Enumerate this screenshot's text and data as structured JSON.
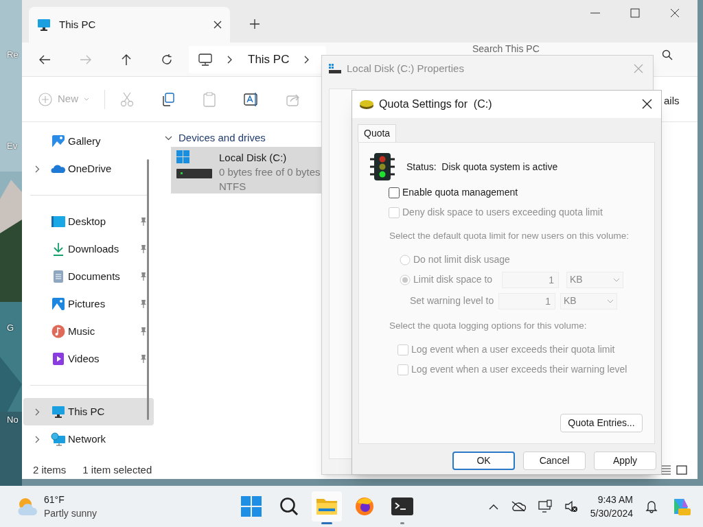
{
  "desktop": {
    "icon_labels": [
      "Re",
      "Ev",
      "G",
      "No"
    ]
  },
  "explorer": {
    "tab": {
      "title": "This PC"
    },
    "address": {
      "segments": [
        "This PC"
      ]
    },
    "search": {
      "placeholder": "Search This PC"
    },
    "toolbar": {
      "new_label": "New",
      "details_label": "ails"
    },
    "sidebar": {
      "groups": [
        [
          {
            "label": "Gallery",
            "expandable": false,
            "pinned": false,
            "selected": false
          },
          {
            "label": "OneDrive",
            "expandable": true,
            "pinned": false,
            "selected": false
          }
        ],
        [
          {
            "label": "Desktop",
            "expandable": false,
            "pinned": true,
            "selected": false
          },
          {
            "label": "Downloads",
            "expandable": false,
            "pinned": true,
            "selected": false
          },
          {
            "label": "Documents",
            "expandable": false,
            "pinned": true,
            "selected": false
          },
          {
            "label": "Pictures",
            "expandable": false,
            "pinned": true,
            "selected": false
          },
          {
            "label": "Music",
            "expandable": false,
            "pinned": true,
            "selected": false
          },
          {
            "label": "Videos",
            "expandable": false,
            "pinned": true,
            "selected": false
          }
        ],
        [
          {
            "label": "This PC",
            "expandable": true,
            "pinned": false,
            "selected": true
          },
          {
            "label": "Network",
            "expandable": true,
            "pinned": false,
            "selected": false
          }
        ]
      ]
    },
    "section": {
      "title": "Devices and drives",
      "expanded": true
    },
    "drives": [
      {
        "name": "Local Disk (C:)",
        "detail": "0 bytes free of 0 bytes",
        "filesystem": "NTFS",
        "selected": true
      }
    ],
    "status_bar": {
      "count": "2 items",
      "selection": "1 item selected"
    }
  },
  "properties_dialog": {
    "title": "Local Disk (C:) Properties"
  },
  "quota_dialog": {
    "title": "Quota Settings for  (C:)",
    "tabs": [
      {
        "label": "Quota",
        "selected": true
      }
    ],
    "status": "Status:  Disk quota system is active",
    "controls": [
      {
        "kind": "checkbox",
        "label": "Enable quota management",
        "checked": false,
        "disabled": false
      },
      {
        "kind": "checkbox",
        "label": "Deny disk space to users exceeding quota limit",
        "checked": false,
        "disabled": true
      },
      {
        "kind": "heading",
        "label": "Select the default quota limit for new users on this volume:"
      },
      {
        "kind": "radio",
        "label": "Do not limit disk usage",
        "selected": false,
        "disabled": true
      },
      {
        "kind": "radio",
        "label": "Limit disk space to",
        "selected": true,
        "disabled": true,
        "value": "1",
        "unit": "KB"
      },
      {
        "kind": "amount",
        "label": "Set warning level to",
        "disabled": true,
        "value": "1",
        "unit": "KB"
      },
      {
        "kind": "heading",
        "label": "Select the quota logging options for this volume:"
      },
      {
        "kind": "subcheckbox",
        "label": "Log event when a user exceeds their quota limit",
        "checked": false,
        "disabled": true
      },
      {
        "kind": "subcheckbox",
        "label": "Log event when a user exceeds their warning level",
        "checked": false,
        "disabled": true
      }
    ],
    "entries_button": "Quota Entries...",
    "buttons": [
      {
        "label": "OK",
        "default": true
      },
      {
        "label": "Cancel",
        "default": false
      },
      {
        "label": "Apply",
        "default": false
      }
    ]
  },
  "taskbar": {
    "weather": {
      "temperature": "61°F",
      "condition": "Partly sunny"
    },
    "apps": [
      {
        "kind": "start",
        "active": false
      },
      {
        "kind": "search",
        "active": false
      },
      {
        "kind": "explorer",
        "active": true
      },
      {
        "kind": "browser",
        "active": false
      },
      {
        "kind": "terminal",
        "active": false
      }
    ],
    "time": "9:43 AM",
    "date": "5/30/2024"
  }
}
